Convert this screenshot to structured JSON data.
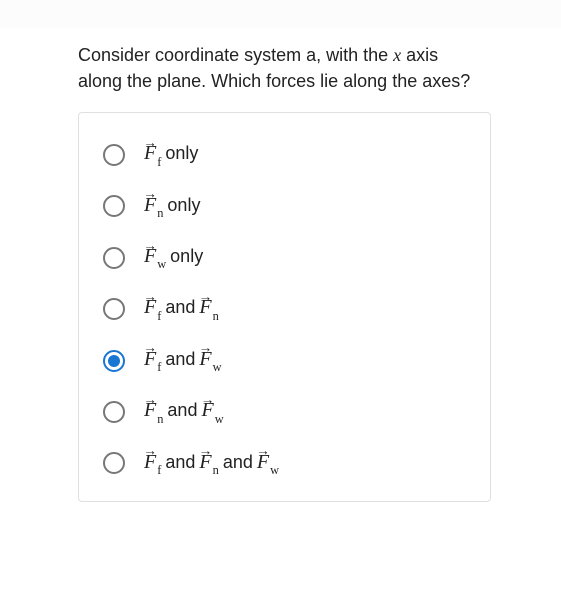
{
  "question": {
    "prefix": "Consider coordinate system a, with the ",
    "italic_x": "x",
    "suffix": " axis along the plane. Which forces lie along the axes?"
  },
  "force_symbol": "F",
  "subscripts": {
    "f": "f",
    "n": "n",
    "w": "w"
  },
  "words": {
    "only": "only",
    "and": "and"
  },
  "options": [
    {
      "type": "one",
      "a": "f",
      "selected": false
    },
    {
      "type": "one",
      "a": "n",
      "selected": false
    },
    {
      "type": "one",
      "a": "w",
      "selected": false
    },
    {
      "type": "two",
      "a": "f",
      "b": "n",
      "selected": false
    },
    {
      "type": "two",
      "a": "f",
      "b": "w",
      "selected": true
    },
    {
      "type": "two",
      "a": "n",
      "b": "w",
      "selected": false
    },
    {
      "type": "three",
      "a": "f",
      "b": "n",
      "c": "w",
      "selected": false
    }
  ]
}
